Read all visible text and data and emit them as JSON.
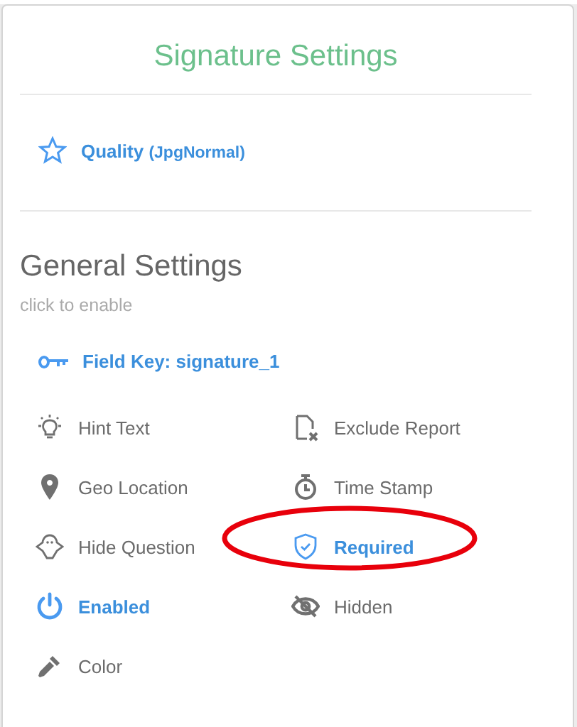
{
  "title": "Signature Settings",
  "quality": {
    "label": "Quality",
    "value": "(JpgNormal)"
  },
  "general": {
    "heading": "General Settings",
    "hint": "click to enable",
    "field_key": "Field Key: signature_1"
  },
  "options": [
    {
      "kind": "hint",
      "label": "Hint Text",
      "on": false,
      "circled": false
    },
    {
      "kind": "exclude",
      "label": "Exclude Report",
      "on": false,
      "circled": false
    },
    {
      "kind": "geo",
      "label": "Geo Location",
      "on": false,
      "circled": false
    },
    {
      "kind": "timestamp",
      "label": "Time Stamp",
      "on": false,
      "circled": false
    },
    {
      "kind": "hide",
      "label": "Hide Question",
      "on": false,
      "circled": false
    },
    {
      "kind": "required",
      "label": "Required",
      "on": true,
      "circled": true
    },
    {
      "kind": "enabled",
      "label": "Enabled",
      "on": true,
      "circled": false
    },
    {
      "kind": "hidden",
      "label": "Hidden",
      "on": false,
      "circled": false
    },
    {
      "kind": "color",
      "label": "Color",
      "on": false,
      "circled": false
    }
  ]
}
